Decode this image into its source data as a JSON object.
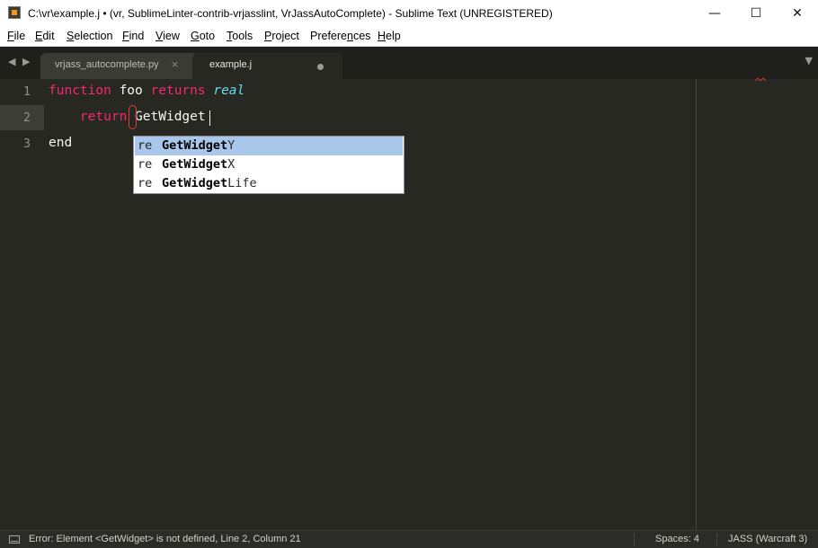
{
  "window": {
    "title": "C:\\vr\\example.j • (vr, SublimeLinter-contrib-vrjasslint, VrJassAutoComplete) - Sublime Text (UNREGISTERED)",
    "minimize_glyph": "—",
    "maximize_glyph": "☐",
    "close_glyph": "✕"
  },
  "menu": [
    {
      "u": "F",
      "rest": "ile"
    },
    {
      "u": "E",
      "rest": "dit"
    },
    {
      "u": "S",
      "rest": "election"
    },
    {
      "u": "F",
      "rest": "ind"
    },
    {
      "u": "V",
      "rest": "iew"
    },
    {
      "u": "G",
      "rest": "oto"
    },
    {
      "u": "T",
      "rest": "ools"
    },
    {
      "u": "P",
      "rest": "roject"
    },
    {
      "u": "",
      "rest": "Preferences",
      "pre": "Prefere",
      "u2": "n",
      "post": "ces"
    },
    {
      "u": "H",
      "rest": "elp"
    }
  ],
  "tabs": {
    "nav_left": "◀",
    "nav_right": "▶",
    "inactive_label": "vrjass_autocomplete.py",
    "close_glyph": "×",
    "active_label": "example.j",
    "menu_glyph": "▼"
  },
  "editor": {
    "line_numbers": [
      "1",
      "2",
      "3"
    ],
    "line1": {
      "kw1": "function",
      "name": " foo ",
      "kw2": "returns",
      "type": "real"
    },
    "line2": {
      "indent": "    ",
      "kw": "return",
      "text": " GetWidget"
    },
    "line3": {
      "text": "end"
    }
  },
  "autocomplete": {
    "items": [
      {
        "hint": "re",
        "match": "GetWidget",
        "rest": "Y",
        "selected": true
      },
      {
        "hint": "re",
        "match": "GetWidget",
        "rest": "X",
        "selected": false
      },
      {
        "hint": "re",
        "match": "GetWidget",
        "rest": "Life",
        "selected": false
      }
    ]
  },
  "status": {
    "message": "Error: Element <GetWidget> is not defined, Line 2, Column 21",
    "spaces": "Spaces: 4",
    "syntax": "JASS (Warcraft 3)"
  },
  "colors": {
    "background": "#272822",
    "keyword": "#f92672",
    "type": "#66d9ef",
    "lint_error": "#e23a3a",
    "selection": "#a9c7ea"
  }
}
